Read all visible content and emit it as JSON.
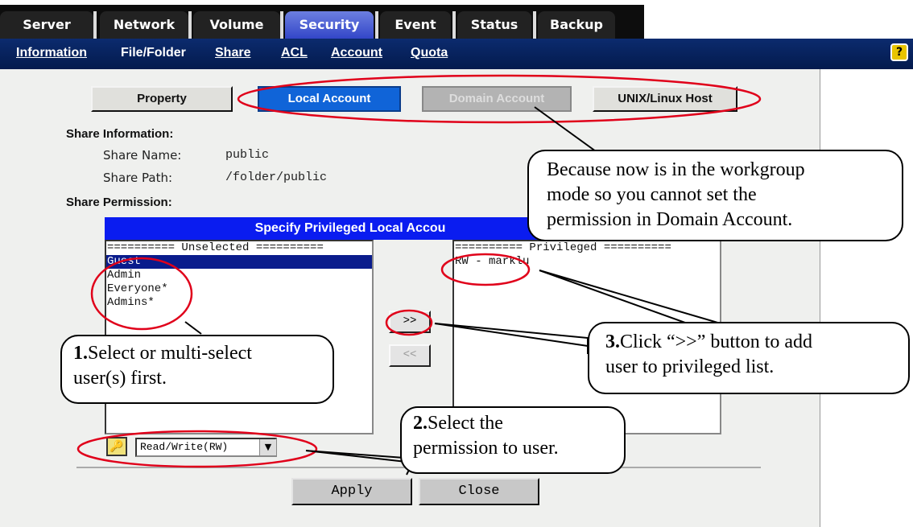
{
  "tabs": [
    {
      "label": "Server",
      "active": false
    },
    {
      "label": "Network",
      "active": false
    },
    {
      "label": "Volume",
      "active": false
    },
    {
      "label": "Security",
      "active": true
    },
    {
      "label": "Event",
      "active": false
    },
    {
      "label": "Status",
      "active": false
    },
    {
      "label": "Backup",
      "active": false
    }
  ],
  "subnav": [
    {
      "label": "Information"
    },
    {
      "label": "File/Folder"
    },
    {
      "label": "Share"
    },
    {
      "label": "ACL"
    },
    {
      "label": "Account"
    },
    {
      "label": "Quota"
    }
  ],
  "help_glyph": "?",
  "buttons": {
    "property": "Property",
    "local": "Local Account",
    "domain": "Domain Account",
    "unix": "UNIX/Linux Host"
  },
  "share_info": {
    "heading": "Share Information:",
    "name_label": "Share Name:",
    "name_value": "public",
    "path_label": "Share Path:",
    "path_value": "/folder/public"
  },
  "perm_heading": "Share Permission:",
  "bar_title": "Specify Privileged Local Accou",
  "unselected": {
    "header": "========== Unselected ==========",
    "items": [
      "Guest",
      "Admin",
      "Everyone*",
      "Admins*"
    ],
    "selected_index": 0
  },
  "privileged": {
    "header": "========== Privileged ==========",
    "items": [
      "RW - marklu"
    ]
  },
  "add_button": ">>",
  "remove_button": "<<",
  "permission_select": "Read/Write(RW)",
  "apply": "Apply",
  "close": "Close",
  "callouts": {
    "domain": [
      "Because now is in the workgroup",
      "mode so you cannot set the",
      "permission in Domain Account."
    ],
    "step1_num": "1.",
    "step1": [
      "Select or multi-select",
      "user(s) first."
    ],
    "step2_num": "2.",
    "step2": [
      "Select the",
      "permission to user."
    ],
    "step3_num": "3.",
    "step3": [
      "Click “>>” button to add",
      "user to privileged list."
    ]
  },
  "colors": {
    "accent": "#1064d8",
    "annotation": "#e0001a",
    "bar": "#0a1cf0"
  }
}
